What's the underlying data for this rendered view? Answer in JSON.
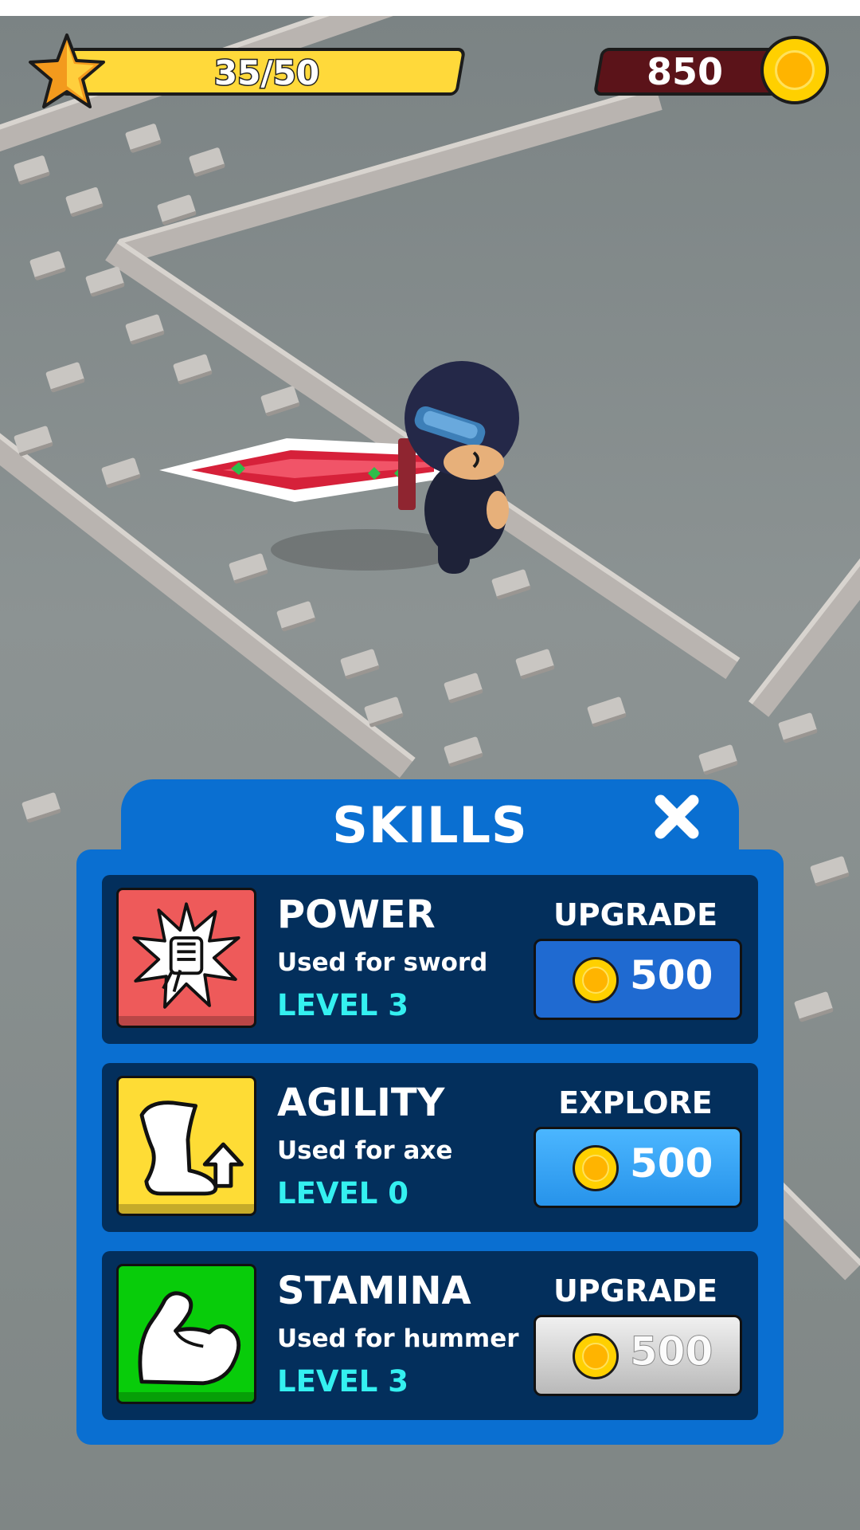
{
  "hud": {
    "xp_text": "35/50",
    "xp_progress": 0.7,
    "coins": "850",
    "icons": {
      "xp": "star-icon",
      "currency": "coin-icon"
    }
  },
  "panel": {
    "title": "SKILLS",
    "close_icon": "close-icon"
  },
  "skills": [
    {
      "name": "POWER",
      "description": "Used for sword",
      "level": "LEVEL 3",
      "action": "UPGRADE",
      "price": "500",
      "icon": "fist-burst-icon",
      "icon_bg": "#ee5a5a",
      "button_style": "dark-blue"
    },
    {
      "name": "AGILITY",
      "description": "Used for axe",
      "level": "LEVEL 0",
      "action": "EXPLORE",
      "price": "500",
      "icon": "boot-arrow-icon",
      "icon_bg": "#fedc35",
      "button_style": "light-blue"
    },
    {
      "name": "STAMINA",
      "description": "Used for hummer",
      "level": "LEVEL 3",
      "action": "UPGRADE",
      "price": "500",
      "icon": "flexed-arm-icon",
      "icon_bg": "#08cc0a",
      "button_style": "gray"
    }
  ],
  "colors": {
    "panel_blue": "#0a6fd1",
    "card_navy": "#032f5c",
    "level_cyan": "#34f0f0",
    "xp_yellow": "#ffd93a",
    "coin_panel": "#5b1319"
  }
}
